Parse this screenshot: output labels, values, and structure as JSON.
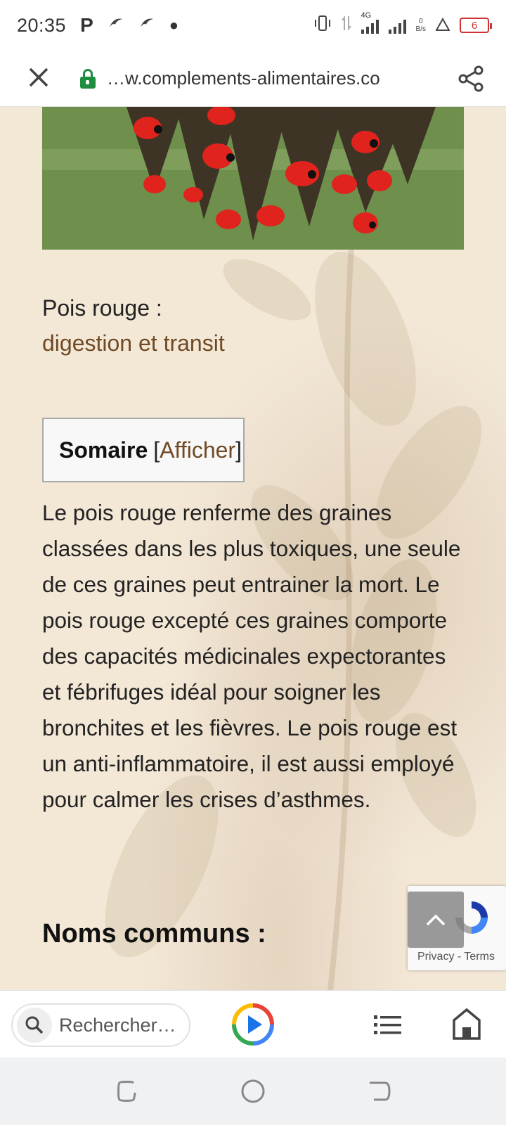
{
  "status_bar": {
    "time": "20:35",
    "network_type": "4G",
    "data_rate_value": "0",
    "data_rate_unit": "B/s",
    "battery_level": "6"
  },
  "url_bar": {
    "url": "…w.complements-alimentaires.co"
  },
  "article": {
    "plant_name": "Pois rouge :",
    "plant_subtitle": "digestion et transit",
    "toc": {
      "title": "Somaire",
      "open_bracket": "[",
      "toggle_label": "Afficher",
      "close_bracket": "]"
    },
    "paragraph": "Le pois rouge renferme des graines classées dans les plus toxiques, une seule de ces graines peut entrainer la mort. Le pois rouge excepté ces graines comporte des capacités médicinales expectorantes et fébrifuges idéal pour soigner les bronchites et les fièvres. Le pois rouge est un anti-inflammatoire, il est aussi employé pour calmer les crises d’asthmes.",
    "section_heading": "Noms communs :"
  },
  "recaptcha": {
    "privacy": "Privacy",
    "separator": " - ",
    "terms": "Terms"
  },
  "browser_bar": {
    "search_placeholder": "Rechercher…"
  },
  "colors": {
    "page_background": "#f3e7d6",
    "link_brown": "#6f4a25",
    "lock_green": "#1e8e3e",
    "battery_red": "#cc3333"
  }
}
